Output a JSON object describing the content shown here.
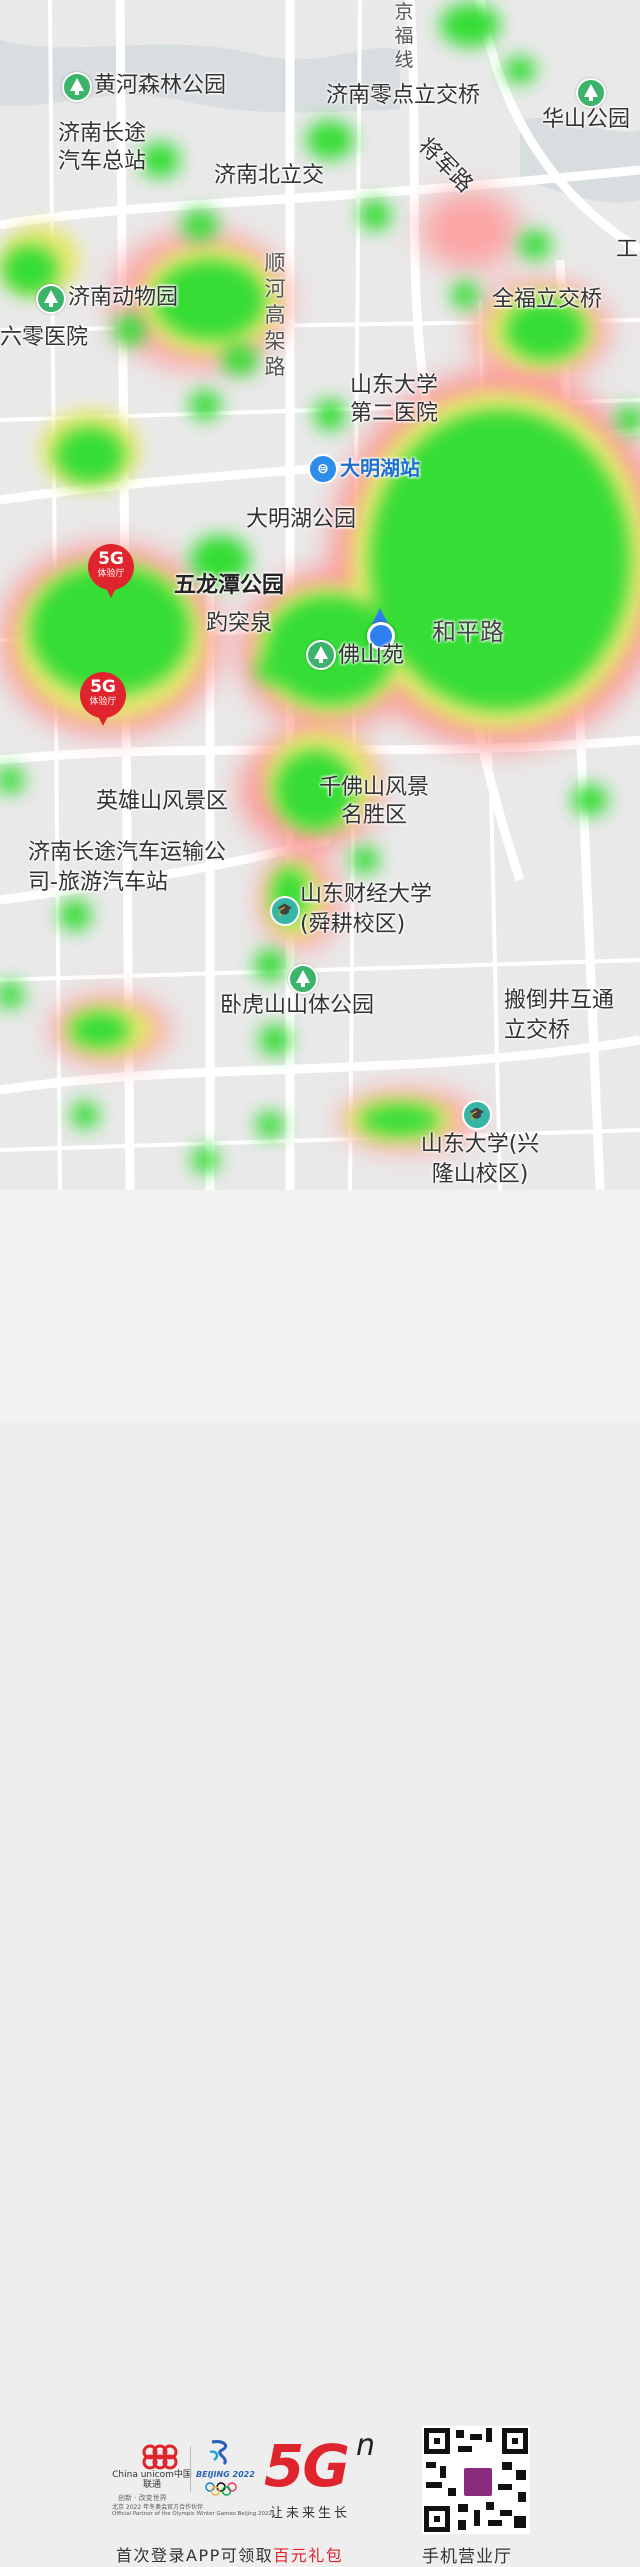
{
  "map": {
    "labels": {
      "jing_fu_line": "京福线",
      "huanghe_forest_park": "黄河森林公园",
      "jinan_zero_point_interchange": "济南零点立交桥",
      "huashan_park": "华山公园",
      "jinan_long_distance_bus_main": "济南长途汽车总站",
      "jinan_north_interchange": "济南北立交",
      "jiangjun_road": "将军路",
      "shunhe_elevated_road": "顺河高架路",
      "jinan_zoo": "济南动物园",
      "quanfu_interchange": "全福立交桥",
      "sixth_zero_hospital": "六零医院",
      "sdu_second_hospital": "山东大学第二医院",
      "daminghu_station": "大明湖站",
      "daminghu_park": "大明湖公园",
      "wulongtan_park": "五龙潭公园",
      "baotu_spring": "趵突泉",
      "heping_road": "和平路",
      "foshan_yuan": "佛山苑",
      "yingxiongshan_scenic": "英雄山风景区",
      "qianfoshan_scenic": "千佛山风景名胜区",
      "jinan_long_distance_bus_company": "济南长途汽车运输公司-旅游汽车站",
      "sdufe_shungeng": "山东财经大学(舜耕校区)",
      "wohushan_park": "卧虎山山体公园",
      "bandaojinghu_interchange": "搬倒井互通立交桥",
      "sdu_xinglongshan": "山东大学(兴隆山校区)",
      "edge_char": "工"
    },
    "pin_5g": {
      "title": "5G",
      "subtitle": "体验厅"
    },
    "colors": {
      "heat_green": "#33dd33",
      "heat_yellow": "#e6e66a",
      "heat_red": "#ff7777",
      "pin_red": "#e0242e",
      "location_blue": "#2f7ff1",
      "park_green": "#3bb36a"
    }
  },
  "footer": {
    "unicom_en": "China unicom中国联通",
    "unicom_slogan": "创新 · 改变世界",
    "olympic_text": "BEIJING 2022",
    "partner_cn": "北京 2022 年冬奥会官方合作伙伴",
    "partner_en": "Official Partner of the Olympic Winter Games Beijing 2022",
    "brand_5g": "5G",
    "brand_sup": "n",
    "brand_slogan": "让未来生长",
    "promo_prefix": "首次登录APP可领取",
    "promo_highlight": "百元礼包",
    "qr_caption": "手机营业厅",
    "colors": {
      "brand_red": "#e0242e",
      "text_dark": "#333333"
    }
  }
}
